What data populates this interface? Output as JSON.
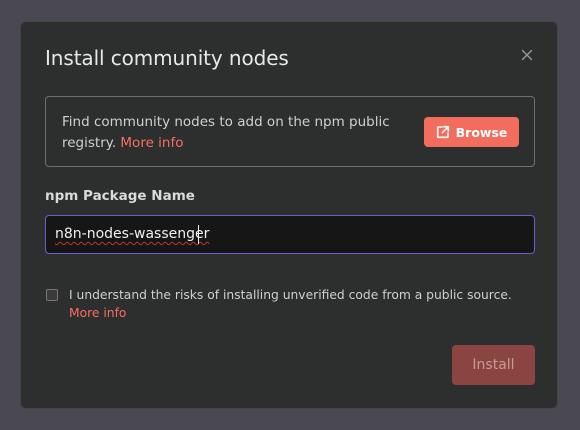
{
  "modal": {
    "title": "Install community nodes",
    "info": {
      "text": "Find community nodes to add on the npm public registry. ",
      "link": "More info"
    },
    "browse_label": "Browse",
    "package_field": {
      "label": "npm Package Name",
      "value": "n8n-nodes-wassenger"
    },
    "risk_checkbox": {
      "checked": false,
      "label": "I understand the risks of installing unverified code from a public source.",
      "link": "More info"
    },
    "install_label": "Install",
    "install_enabled": false
  },
  "colors": {
    "accent": "#f36d5f",
    "link": "#f76e60",
    "input_focus": "#6a5fd2",
    "modal_bg": "#2d2e2e",
    "backdrop": "#4a4851"
  },
  "icons": {
    "close": "close-icon",
    "browse": "external-link-icon"
  }
}
